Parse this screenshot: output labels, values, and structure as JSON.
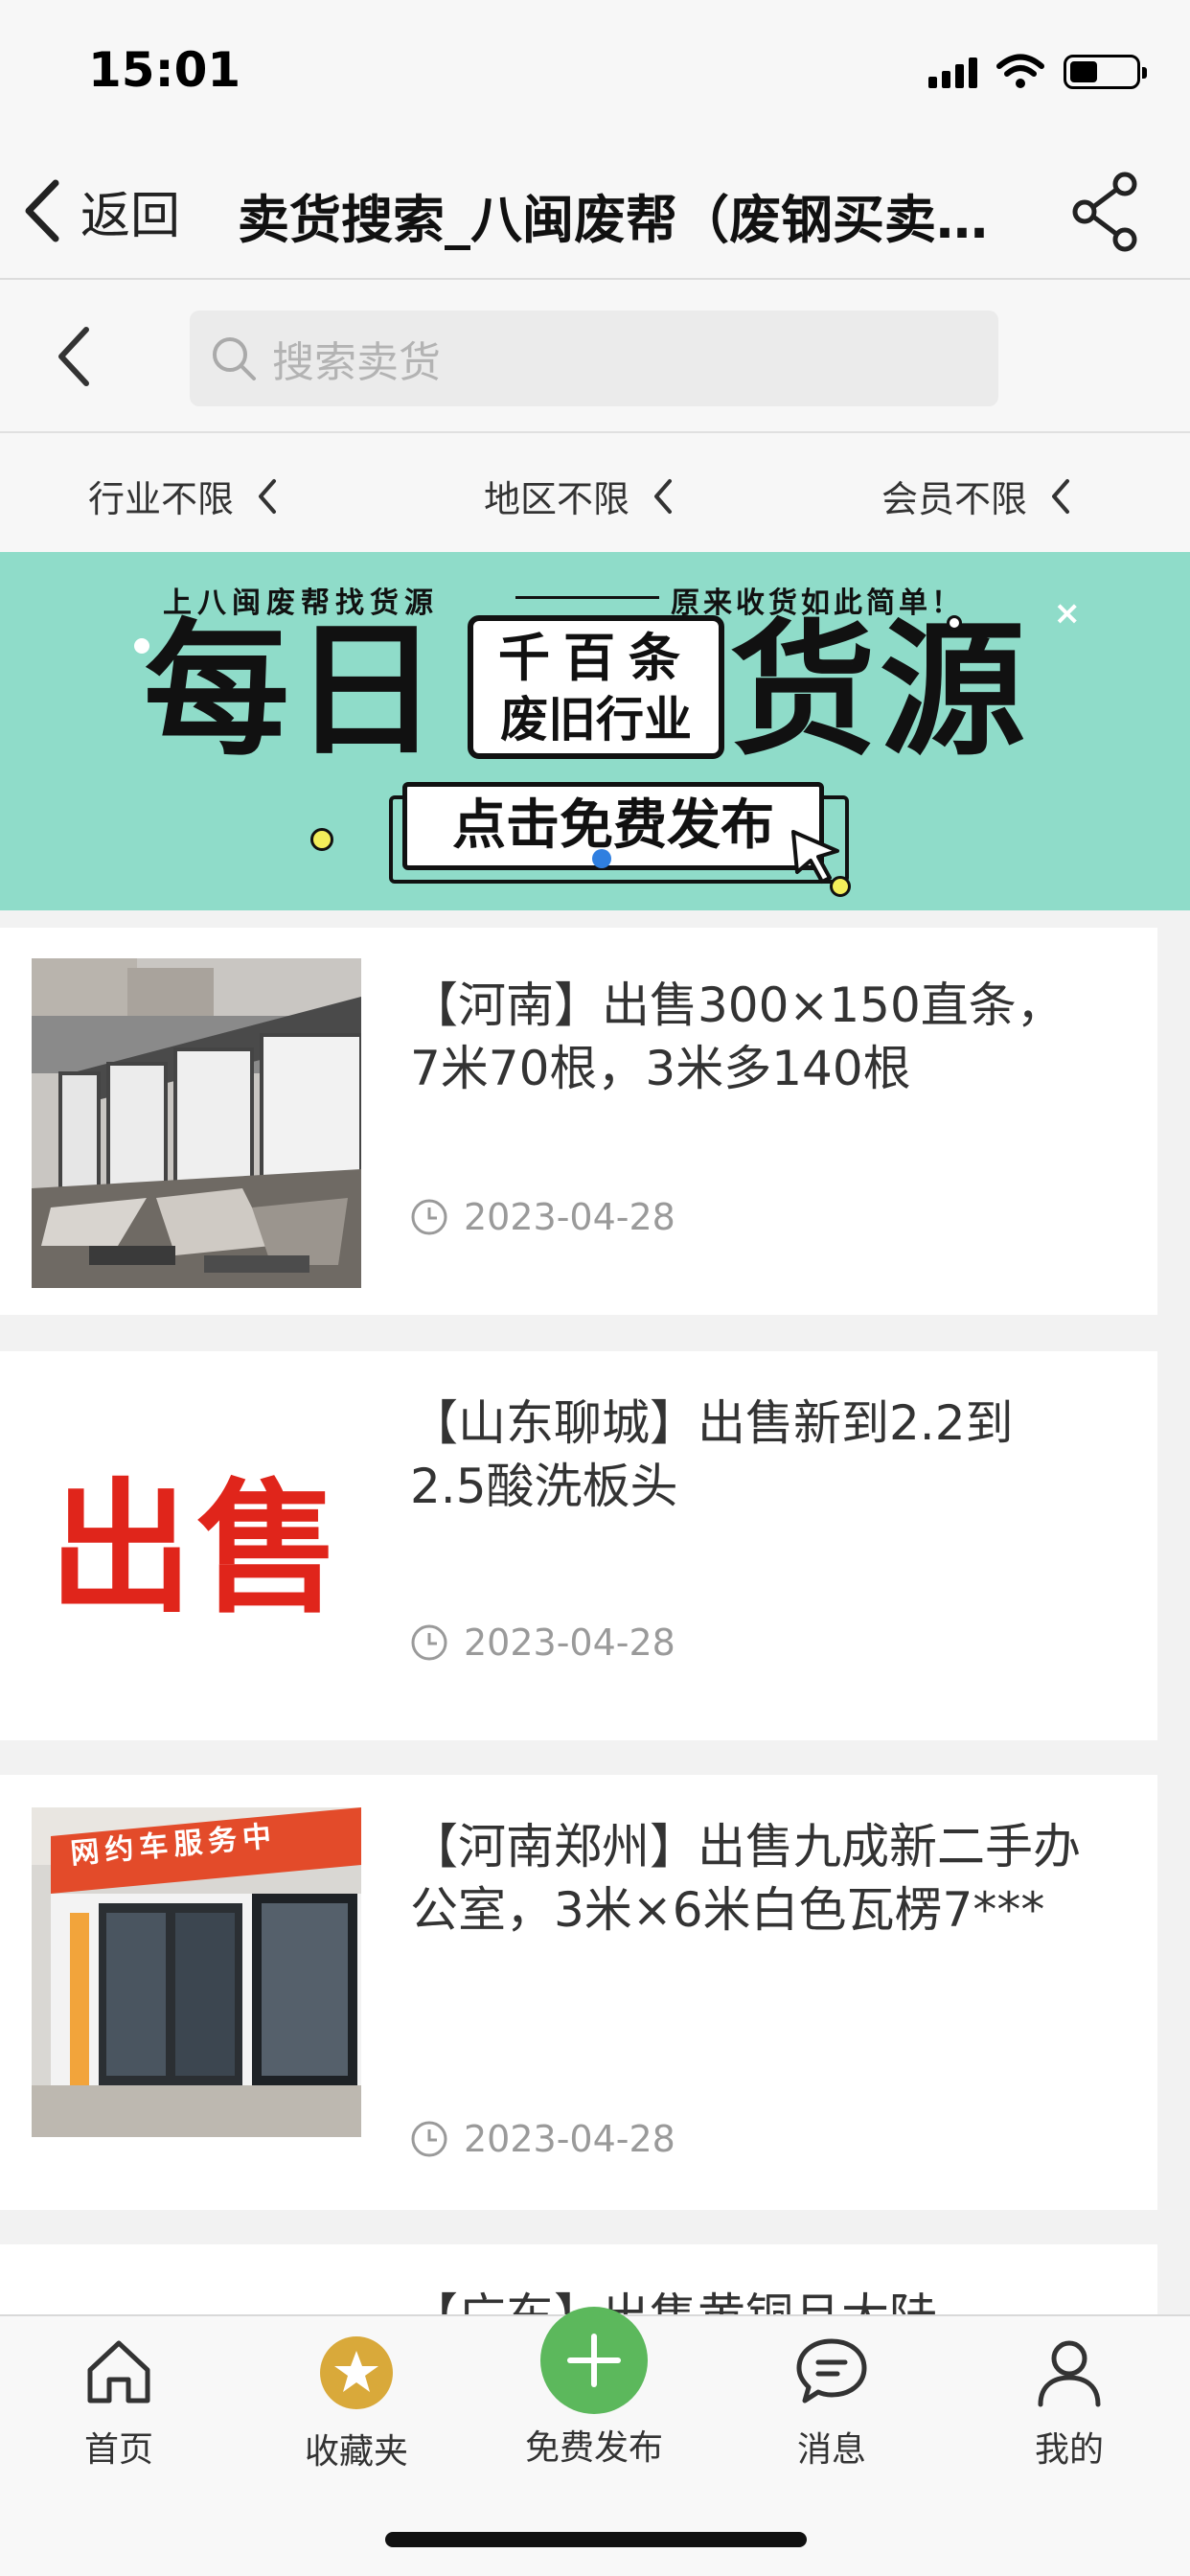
{
  "status_bar": {
    "time": "15:01"
  },
  "nav": {
    "back_label": "返回",
    "title": "卖货搜索_八闽废帮（废钢买卖…"
  },
  "search": {
    "placeholder": "搜索卖货"
  },
  "filters": [
    {
      "label": "行业不限"
    },
    {
      "label": "地区不限"
    },
    {
      "label": "会员不限"
    }
  ],
  "banner": {
    "top_left": "上八闽废帮找货源",
    "top_right": "原来收货如此简单！",
    "big_left": "每日",
    "box_line1": "千百条",
    "box_line2": "废旧行业",
    "big_right": "货源",
    "cta": "点击免费发布",
    "close": "×"
  },
  "listings": [
    {
      "title": "【河南】出售300×150直条，7米70根，3米多140根",
      "date": "2023-04-28",
      "thumb": "demolition-photo"
    },
    {
      "title": "【山东聊城】出售新到2.2到2.5酸洗板头",
      "date": "2023-04-28",
      "thumb": "sale-text-image",
      "thumb_text": "出售"
    },
    {
      "title": "【河南郑州】出售九成新二手办公室，3米×6米白色瓦楞7***",
      "date": "2023-04-28",
      "thumb": "storefront-photo",
      "thumb_sign": "网约车服务中"
    },
    {
      "title": "【广东】出售黄铜旦大陆",
      "date": ""
    }
  ],
  "tabbar": [
    {
      "label": "首页",
      "icon": "home-icon"
    },
    {
      "label": "收藏夹",
      "icon": "star-icon"
    },
    {
      "label": "免费发布",
      "icon": "plus-icon"
    },
    {
      "label": "消息",
      "icon": "chat-icon"
    },
    {
      "label": "我的",
      "icon": "user-icon"
    }
  ],
  "colors": {
    "banner_bg": "#8fdcc9",
    "star_badge": "#d9a93a",
    "publish_green": "#5cb85c",
    "sale_red": "#e0251b"
  }
}
